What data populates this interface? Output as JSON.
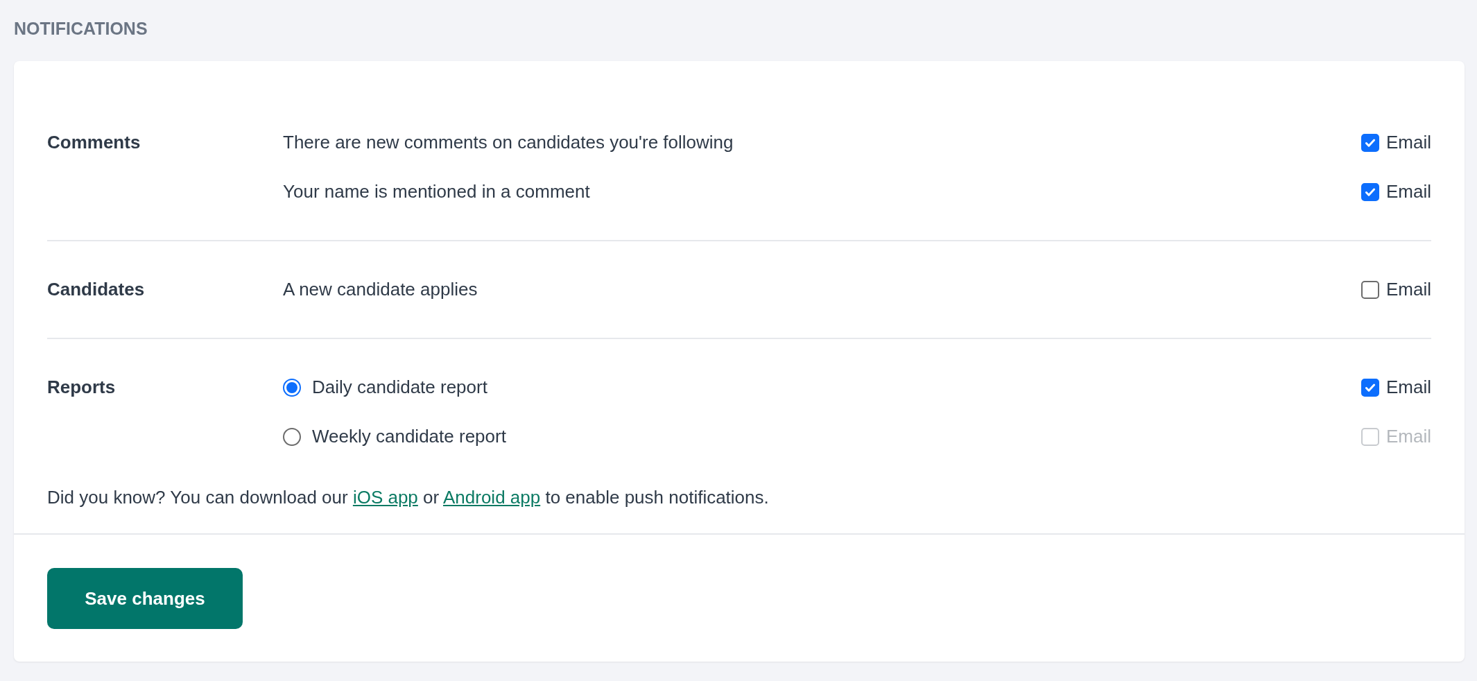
{
  "heading": "NOTIFICATIONS",
  "groups": [
    {
      "label": "Comments",
      "rows": [
        {
          "kind": "text",
          "text": "There are new comments on candidates you're following",
          "email": {
            "label": "Email",
            "checked": true,
            "disabled": false
          }
        },
        {
          "kind": "text",
          "text": "Your name is mentioned in a comment",
          "email": {
            "label": "Email",
            "checked": true,
            "disabled": false
          }
        }
      ]
    },
    {
      "label": "Candidates",
      "rows": [
        {
          "kind": "text",
          "text": "A new candidate applies",
          "email": {
            "label": "Email",
            "checked": false,
            "disabled": false
          }
        }
      ]
    },
    {
      "label": "Reports",
      "rows": [
        {
          "kind": "radio",
          "text": "Daily candidate report",
          "selected": true,
          "email": {
            "label": "Email",
            "checked": true,
            "disabled": false
          }
        },
        {
          "kind": "radio",
          "text": "Weekly candidate report",
          "selected": false,
          "email": {
            "label": "Email",
            "checked": false,
            "disabled": true
          }
        }
      ]
    }
  ],
  "info": [
    {
      "kind": "text",
      "text": "Did you know? You can download our "
    },
    {
      "kind": "link",
      "text": "iOS app"
    },
    {
      "kind": "text",
      "text": " or "
    },
    {
      "kind": "link",
      "text": "Android app"
    },
    {
      "kind": "text",
      "text": " to enable push notifications."
    }
  ],
  "save_button": "Save changes"
}
